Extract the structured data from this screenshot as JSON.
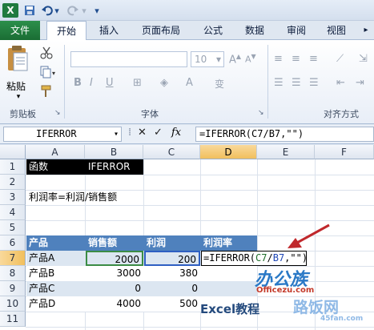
{
  "window": {
    "app_icon_letter": "X"
  },
  "ribbon_tabs": [
    "文件",
    "开始",
    "插入",
    "页面布局",
    "公式",
    "数据",
    "审阅",
    "视图"
  ],
  "ribbon": {
    "paste_label": "粘贴",
    "clipboard_label": "剪贴板",
    "font_group_label": "字体",
    "font_size": "10",
    "align_group_label": "对齐方式"
  },
  "formula_bar": {
    "name_box": "IFERROR",
    "formula": "=IFERROR(C7/B7,\"\")"
  },
  "sheet": {
    "columns": [
      "A",
      "B",
      "C",
      "D",
      "E",
      "F"
    ],
    "rows": [
      "1",
      "2",
      "3",
      "4",
      "5",
      "6",
      "7",
      "8",
      "9",
      "10",
      "11"
    ],
    "cells": {
      "A1": "函数",
      "B1": "IFERROR",
      "A3": "利润率=利润/销售额",
      "A6": "产品",
      "B6": "销售额",
      "C6": "利润",
      "D6": "利润率",
      "A7": "产品A",
      "B7": "2000",
      "C7": "200",
      "D7_prefix": "=IFERROR(",
      "D7_ref1": "C7",
      "D7_slash": "/",
      "D7_ref2": "B7",
      "D7_suffix": ",\"\")",
      "A8": "产品B",
      "B8": "3000",
      "C8": "380",
      "A9": "产品C",
      "B9": "0",
      "C9": "0",
      "A10": "产品D",
      "B10": "4000",
      "C10": "500"
    },
    "active_cell": "D7"
  },
  "watermarks": {
    "logo1": "办公族",
    "logo1_sub": "Officezu.com",
    "logo2": "Excel教程",
    "logo3": "路饭网",
    "logo3_sub": "45fan.com"
  },
  "colors": {
    "header_band": "#4f81bd",
    "light_band": "#dce6f1",
    "arrow": "#c0282c",
    "ref1": "#1f6e2a",
    "ref2": "#1f47b5"
  }
}
